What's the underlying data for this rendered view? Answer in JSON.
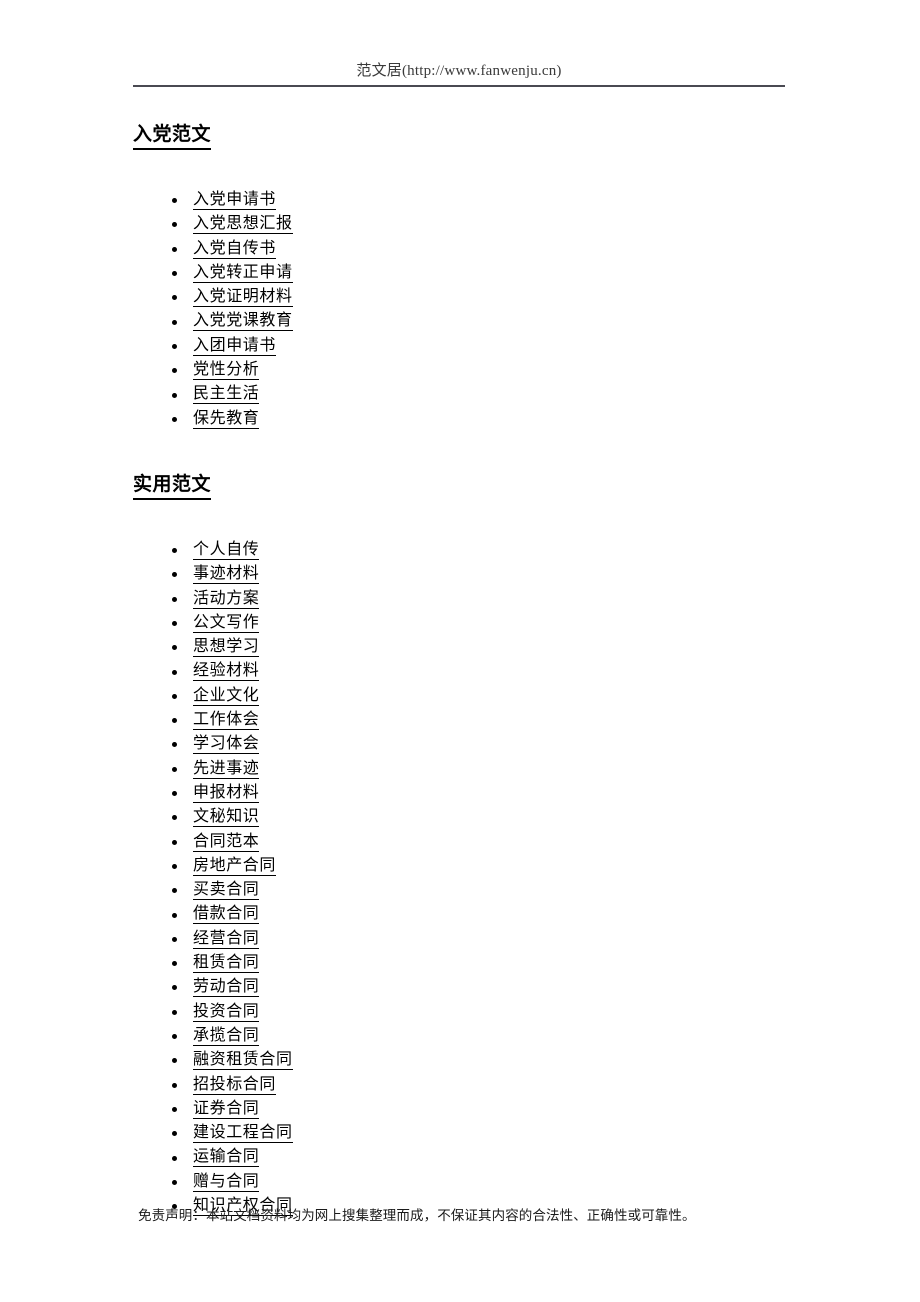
{
  "header": {
    "site_text": "范文居(http://www.fanwenju.cn)"
  },
  "sections": [
    {
      "heading": "入党范文",
      "items": [
        "入党申请书",
        "入党思想汇报",
        "入党自传书",
        "入党转正申请",
        "入党证明材料",
        "入党党课教育",
        "入团申请书",
        "党性分析",
        "民主生活",
        "保先教育"
      ]
    },
    {
      "heading": "实用范文",
      "items": [
        "个人自传",
        "事迹材料",
        "活动方案",
        "公文写作",
        "思想学习",
        "经验材料",
        "企业文化",
        "工作体会",
        "学习体会",
        "先进事迹",
        "申报材料",
        "文秘知识",
        "合同范本",
        "房地产合同",
        "买卖合同",
        "借款合同",
        "经营合同",
        "租赁合同",
        "劳动合同",
        "投资合同",
        "承揽合同",
        "融资租赁合同",
        "招投标合同",
        "证券合同",
        "建设工程合同",
        "运输合同",
        "赠与合同",
        "知识产权合同"
      ]
    }
  ],
  "footer": {
    "disclaimer": "免责声明：本站文档资料均为网上搜集整理而成，不保证其内容的合法性、正确性或可靠性。"
  },
  "colors": {
    "text": "#000000",
    "header_text": "#3a3a3a",
    "rule": "#4a4a52"
  }
}
